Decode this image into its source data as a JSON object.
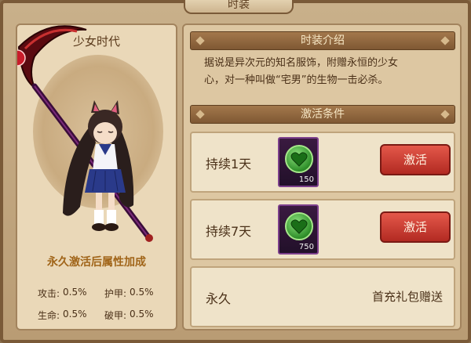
{
  "window": {
    "tab_title": "时装"
  },
  "character": {
    "name": "少女时代",
    "permanent_bonus_title": "永久激活后属性加成",
    "stats": [
      {
        "label": "攻击:",
        "value": "0.5%"
      },
      {
        "label": "护甲:",
        "value": "0.5%"
      },
      {
        "label": "生命:",
        "value": "0.5%"
      },
      {
        "label": "破甲:",
        "value": "0.5%"
      }
    ]
  },
  "intro": {
    "header": "时装介绍",
    "line1": "据说是异次元的知名服饰，附赠永恒的少女",
    "line2": "心，对一种叫做“宅男”的生物一击必杀。"
  },
  "conditions": {
    "header": "激活条件",
    "rows": [
      {
        "label": "持续1天",
        "qty": "150",
        "button": "激活"
      },
      {
        "label": "持续7天",
        "qty": "750",
        "button": "激活"
      }
    ],
    "permanent": {
      "label": "永久",
      "note": "首充礼包赠送"
    }
  },
  "colors": {
    "accent": "#b22a22",
    "header": "#7f5833",
    "bonus_title": "#a06418"
  },
  "icons": {
    "item": "green-heart-coin-icon",
    "weapon": "scythe-icon"
  }
}
